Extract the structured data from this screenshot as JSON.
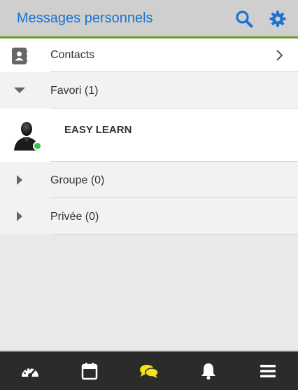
{
  "header": {
    "title": "Messages personnels",
    "icons": [
      "search-icon",
      "gear-icon"
    ],
    "accent": "#1a73d1",
    "underline_color": "#6a9e1f"
  },
  "list": {
    "contacts_label": "Contacts",
    "groups": [
      {
        "label": "Favori (1)",
        "expanded": true
      },
      {
        "label": "Groupe (0)",
        "expanded": false
      },
      {
        "label": "Privée (0)",
        "expanded": false
      }
    ],
    "favori_items": [
      {
        "name": "EASY LEARN",
        "status": "online",
        "status_color": "#3bbf4a"
      }
    ]
  },
  "footer": {
    "items": [
      {
        "icon": "dashboard-icon",
        "active": false
      },
      {
        "icon": "calendar-icon",
        "active": false
      },
      {
        "icon": "chat-icon",
        "active": true,
        "color": "#f5e415"
      },
      {
        "icon": "bell-icon",
        "active": false
      },
      {
        "icon": "menu-icon",
        "active": false
      }
    ]
  }
}
